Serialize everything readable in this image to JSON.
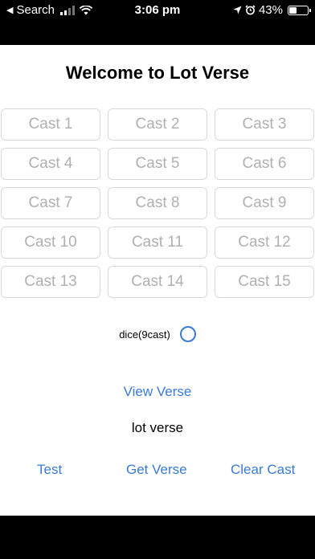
{
  "status_bar": {
    "back_label": "Search",
    "time": "3:06 pm",
    "battery": "43%",
    "battery_level": 0.43,
    "icons": [
      "back-arrow-icon",
      "signal-icon",
      "wifi-icon",
      "location-icon",
      "alarm-icon",
      "battery-icon"
    ]
  },
  "page": {
    "title": "Welcome to Lot Verse"
  },
  "casts": [
    "Cast 1",
    "Cast 2",
    "Cast 3",
    "Cast 4",
    "Cast 5",
    "Cast 6",
    "Cast 7",
    "Cast 8",
    "Cast 9",
    "Cast 10",
    "Cast 11",
    "Cast 12",
    "Cast 13",
    "Cast 14",
    "Cast 15"
  ],
  "dice": {
    "label": "dice(9cast)",
    "checked": false
  },
  "view_verse_label": "View Verse",
  "verse_text": "lot verse",
  "actions": {
    "test_label": "Test",
    "get_verse_label": "Get Verse",
    "clear_cast_label": "Clear Cast"
  },
  "colors": {
    "accent": "#3a7bd5",
    "cell_border": "#d9d9d9",
    "cell_text": "#b0b0b0"
  }
}
